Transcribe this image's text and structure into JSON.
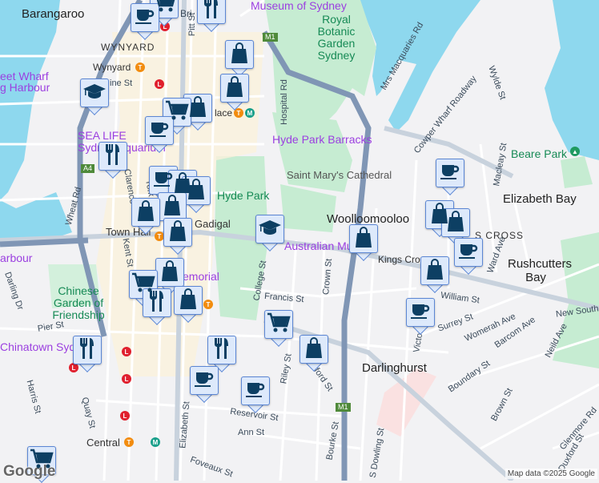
{
  "colors": {
    "water": "#8ed8ee",
    "park": "#c6ecd2",
    "road": "#ffffff",
    "major_road": "#aebccc",
    "motorway": "#7f95b3",
    "marker_bg": "#dde9fb",
    "marker_border": "#5b86d4",
    "marker_icon": "#0d3f63",
    "poi": "#9b3fe0",
    "park_label": "#168a55"
  },
  "labels": {
    "suburbs": [
      "Barangaroo",
      "WYNYARD",
      "Woolloomooloo",
      "Elizabeth Bay",
      "Rushcutters Bay",
      "Darlinghurst",
      "S CROSS"
    ],
    "pois": [
      "Museum of Sydney",
      "Hyde Park Barracks",
      "SEA LIFE Sydney Aquarium",
      "eet Wharf",
      "g Harbour",
      "Australian Mu",
      "emorial",
      "Chinatown Syd",
      "arbour"
    ],
    "parks": [
      "Royal Botanic Garden Sydney",
      "Hyde Park",
      "Chinese Garden of Friendship",
      "Beare Park",
      "Saint Mary's Cathedral"
    ],
    "stations": [
      "Wynyard",
      "Town Hall",
      "Gadigal",
      "Central",
      "Kings Cross",
      "lace"
    ],
    "streets": [
      "Pitt St",
      "Bri",
      "Hospital Rd",
      "Mrs Macquaries Rd",
      "Cowper Wharf Roadway",
      "Wylde St",
      "Macleay St",
      "Wheat Rd",
      "Clarence St",
      "Kent St",
      "York St",
      "College St",
      "Francis St",
      "Crown St",
      "William St",
      "Surrey St",
      "Womerah Ave",
      "Barcom Ave",
      "New South",
      "Neild Ave",
      "Boundary St",
      "Victoria St",
      "Riley St",
      "Oxford St",
      "Reservoir St",
      "Ann St",
      "Elizabeth St",
      "Pier St",
      "Harris St",
      "Quay St",
      "Darling Dr",
      "Bourke St",
      "S Dowling St",
      "Brown St",
      "Glenmore Rd",
      "Foveaux St",
      "Ward Ave",
      "ine St",
      "Duxford St"
    ],
    "shields": [
      "M1",
      "A4",
      "M1"
    ]
  },
  "markers": [
    {
      "type": "shopping-cart",
      "label": "Supermarket"
    },
    {
      "type": "coffee",
      "label": "Cafe"
    },
    {
      "type": "restaurant",
      "label": "Restaurant"
    },
    {
      "type": "shopping-bag",
      "label": "Shop"
    },
    {
      "type": "shopping-bag",
      "label": "Shop"
    },
    {
      "type": "education",
      "label": "School"
    },
    {
      "type": "shopping-bag",
      "label": "Shop"
    },
    {
      "type": "shopping-cart",
      "label": "Supermarket"
    },
    {
      "type": "coffee",
      "label": "Cafe"
    },
    {
      "type": "restaurant",
      "label": "Restaurant"
    },
    {
      "type": "coffee",
      "label": "Cafe"
    },
    {
      "type": "shopping-bag",
      "label": "Shop"
    },
    {
      "type": "shopping-bag",
      "label": "Shop"
    },
    {
      "type": "shopping-bag",
      "label": "Shop"
    },
    {
      "type": "shopping-bag",
      "label": "Shop"
    },
    {
      "type": "shopping-bag",
      "label": "Shop"
    },
    {
      "type": "education",
      "label": "School"
    },
    {
      "type": "shopping-bag",
      "label": "Shop"
    },
    {
      "type": "coffee",
      "label": "Cafe"
    },
    {
      "type": "shopping-bag",
      "label": "Shop"
    },
    {
      "type": "shopping-bag",
      "label": "Shop"
    },
    {
      "type": "coffee",
      "label": "Cafe"
    },
    {
      "type": "shopping-bag",
      "label": "Shop"
    },
    {
      "type": "coffee",
      "label": "Cafe"
    },
    {
      "type": "shopping-bag",
      "label": "Shop"
    },
    {
      "type": "shopping-cart",
      "label": "Supermarket"
    },
    {
      "type": "restaurant",
      "label": "Restaurant"
    },
    {
      "type": "shopping-bag",
      "label": "Shop"
    },
    {
      "type": "shopping-cart",
      "label": "Supermarket"
    },
    {
      "type": "restaurant",
      "label": "Restaurant"
    },
    {
      "type": "restaurant",
      "label": "Restaurant"
    },
    {
      "type": "coffee",
      "label": "Cafe"
    },
    {
      "type": "coffee",
      "label": "Cafe"
    },
    {
      "type": "shopping-bag",
      "label": "Shop"
    },
    {
      "type": "shopping-cart",
      "label": "Supermarket"
    }
  ],
  "footer": {
    "logo": "Google",
    "attribution": "Map data ©2025 Google"
  }
}
